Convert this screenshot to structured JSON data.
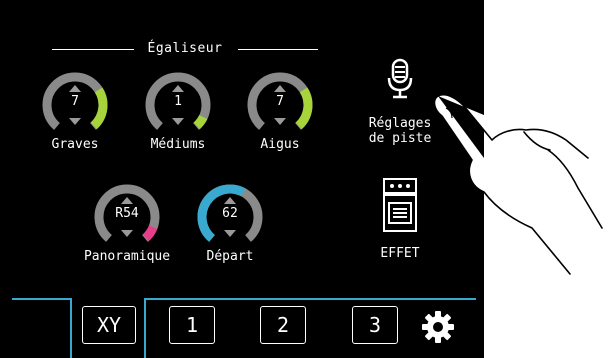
{
  "equalizer": {
    "title": "Égaliseur",
    "knobs": [
      {
        "label": "Graves",
        "value": "7",
        "level": 0.18,
        "accent": "#a7d43a"
      },
      {
        "label": "Médiums",
        "value": "1",
        "level": 0.05,
        "accent": "#a7d43a"
      },
      {
        "label": "Aigus",
        "value": "7",
        "level": 0.18,
        "accent": "#a7d43a"
      }
    ]
  },
  "pan_knob": {
    "label": "Panoramique",
    "value": "R54",
    "level": 0.06,
    "accent": "#e83d8a"
  },
  "send_knob": {
    "label": "Départ",
    "value": "62",
    "level": 0.6,
    "accent": "#3aa9d0"
  },
  "track_settings": {
    "label_line1": "Réglages",
    "label_line2": "de piste",
    "icon": "microphone-icon"
  },
  "effect": {
    "label": "EFFET",
    "icon": "effect-unit-icon"
  },
  "tabs": {
    "xy": "XY",
    "t1": "1",
    "t2": "2",
    "t3": "3",
    "settings_icon": "gear-icon"
  },
  "colors": {
    "background": "#000000",
    "arc": "#8a8a8a",
    "tab_accent": "#3aa9d0"
  }
}
